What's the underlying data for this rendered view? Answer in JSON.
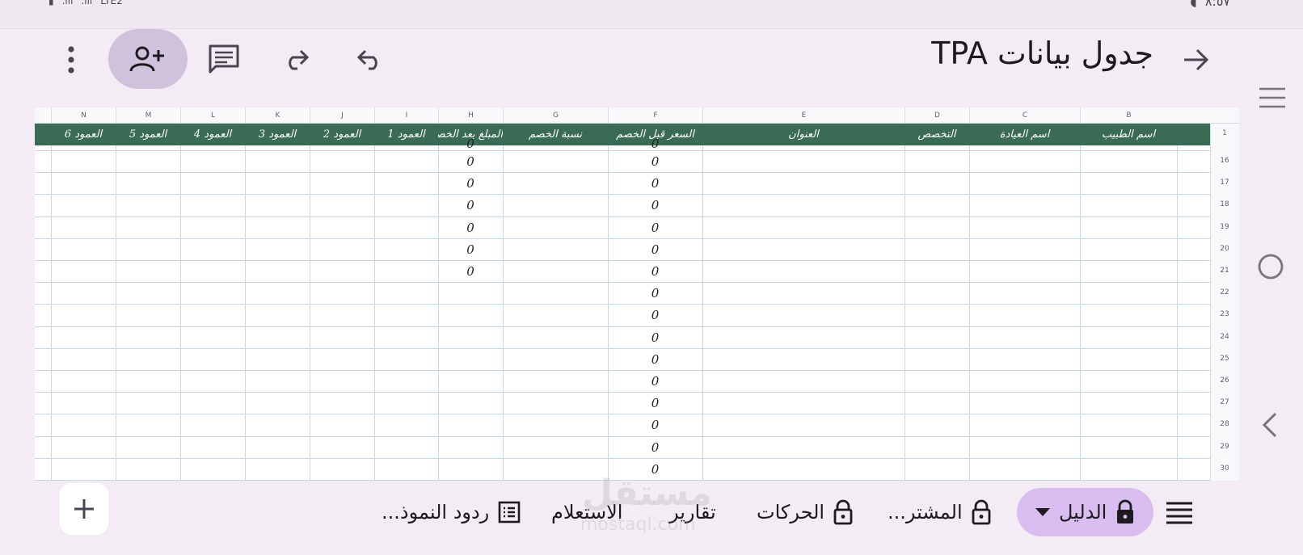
{
  "status": {
    "left": "LTE2",
    "right": "٨:٥٧"
  },
  "appbar": {
    "title": "جدول بيانات TPA"
  },
  "sheet": {
    "columns": [
      "N",
      "M",
      "L",
      "K",
      "J",
      "I",
      "H",
      "G",
      "F",
      "E",
      "D",
      "C",
      "B"
    ],
    "headers": [
      "العمود 6",
      "العمود 5",
      "العمود 4",
      "العمود 3",
      "العمود 2",
      "العمود 1",
      "المبلغ بعد الخصم",
      "نسبة الخصم",
      "السعر قبل الخصم",
      "العنوان",
      "التخصص",
      "اسم العيادة",
      "اسم الطبيب"
    ],
    "header_row_number": "1",
    "row_numbers": [
      "16",
      "17",
      "18",
      "19",
      "20",
      "21",
      "22",
      "23",
      "24",
      "25",
      "26",
      "27",
      "28",
      "29",
      "30"
    ],
    "col_h_values": [
      "0",
      "0",
      "0",
      "0",
      "0",
      "0",
      "0"
    ],
    "col_f_values": [
      "0",
      "0",
      "0",
      "0",
      "0",
      "0",
      "0",
      "0",
      "0",
      "0",
      "0",
      "0",
      "0",
      "0",
      "0",
      "0"
    ]
  },
  "tabs": [
    {
      "label": "الدليل",
      "icon": "lock-icon",
      "active": true
    },
    {
      "label": "المشتر...",
      "icon": "lock-icon",
      "active": false
    },
    {
      "label": "الحركات",
      "icon": "lock-icon",
      "active": false
    },
    {
      "label": "تقارير",
      "icon": "",
      "active": false
    },
    {
      "label": "الاستعلام",
      "icon": "",
      "active": false
    },
    {
      "label": "ردود النموذ...",
      "icon": "form-icon",
      "active": false
    }
  ],
  "watermark": {
    "main": "مستقل",
    "sub": "mostaql.com"
  },
  "colors": {
    "header_band": "#3a6b54",
    "active_tab": "#d9bdf0",
    "share_button": "#cfc2dd"
  }
}
